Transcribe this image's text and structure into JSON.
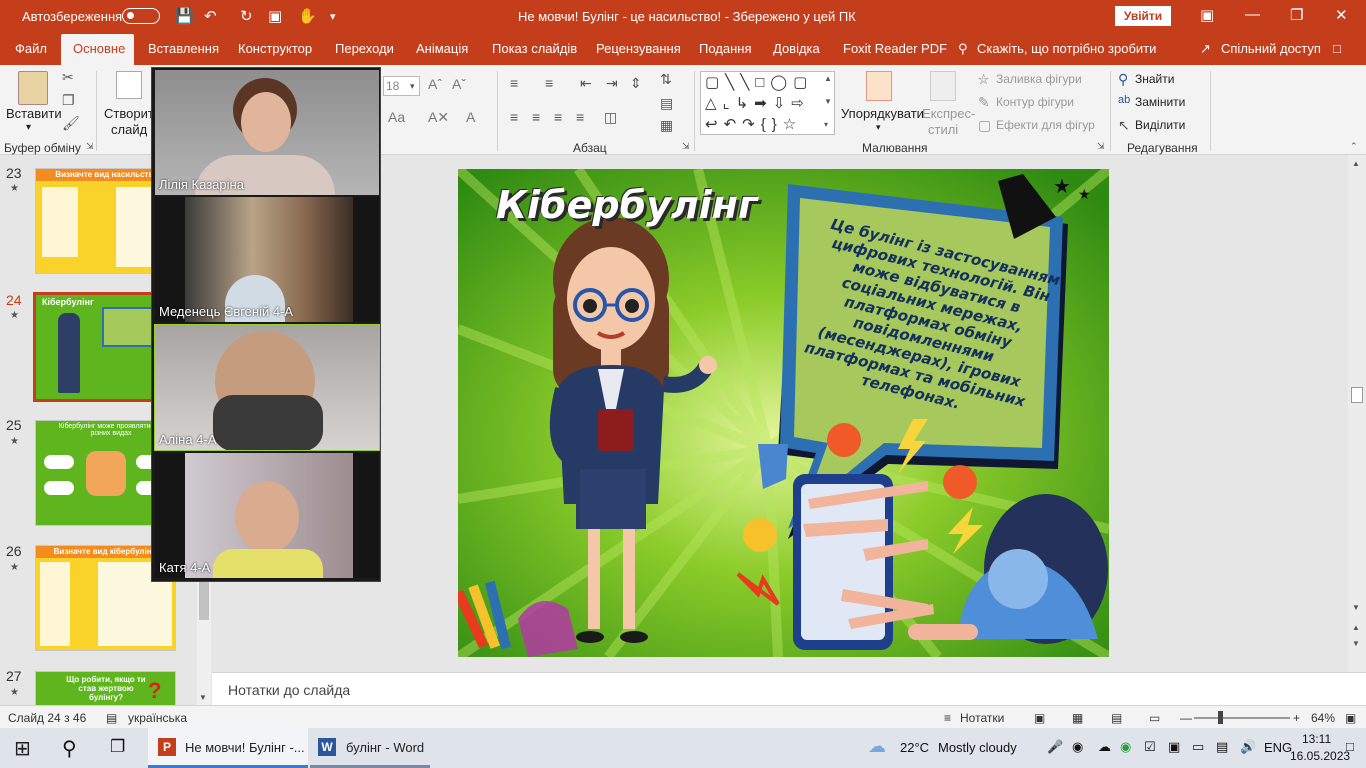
{
  "titlebar": {
    "autosave_label": "Автозбереження",
    "doc_title": "Не мовчи! Булінг - це насильство!  -  Збережено у цей ПК",
    "signin_label": "Увійти"
  },
  "tabs": [
    "Файл",
    "Основне",
    "Вставлення",
    "Конструктор",
    "Переходи",
    "Анімація",
    "Показ слайдів",
    "Рецензування",
    "Подання",
    "Довідка",
    "Foxit Reader PDF",
    "Скажіть, що потрібно зробити",
    "Спільний доступ"
  ],
  "ribbon": {
    "paste_label": "Вставити",
    "create_slide_label": "Створити",
    "create_slide_label2": "слайд",
    "clipboard_group": "Буфер обміну",
    "font_size": "18",
    "paragraph_group": "Абзац",
    "arrange_label": "Упорядкувати",
    "quick_styles_label": "Експрес-",
    "quick_styles_label2": "стилі",
    "shape_fill": "Заливка фігури",
    "shape_outline": "Контур фігури",
    "shape_effects": "Ефекти для фігур",
    "drawing_group": "Малювання",
    "find_label": "Знайти",
    "replace_label": "Замінити",
    "select_label": "Виділити",
    "editing_group": "Редагування"
  },
  "thumbnails": [
    {
      "number": "23",
      "title": "Визначте вид насильства"
    },
    {
      "number": "24",
      "title": "Кібербулінг"
    },
    {
      "number": "25",
      "title": "Кібербулінг може проявлятися у різних видах"
    },
    {
      "number": "26",
      "title": "Визначте вид кібербулінгу"
    },
    {
      "number": "27",
      "title": "Що робити, якщо ти став жертвою булінгу?"
    }
  ],
  "slide": {
    "title": "Кібербулінг",
    "bubble_text": "Це булінг із застосуванням цифрових технологій. Він може відбуватися в соціальних мережах, платформах обміну повідомленнями (месенджерах), ігрових платформах та мобільних телефонах."
  },
  "participants": [
    {
      "name": "Лілія Казаріна"
    },
    {
      "name": "Меденець Євгеній 4-А"
    },
    {
      "name": "Аліна 4-А"
    },
    {
      "name": "Катя  4-А"
    }
  ],
  "notes_placeholder": "Нотатки до слайда",
  "status": {
    "slide_counter": "Слайд 24 з 46",
    "language": "українська",
    "notes_label": "Нотатки",
    "zoom": "64%"
  },
  "taskbar": {
    "app1": "Не мовчи! Булінг -...",
    "app2": "булінг - Word",
    "weather_temp": "22°C",
    "weather_desc": "Mostly cloudy",
    "lang": "ENG",
    "time": "13:11",
    "date": "16.05.2023"
  },
  "colors": {
    "accent": "#c43e1c",
    "slide_green": "#5fb51e",
    "title_orange": "#f7941d"
  }
}
